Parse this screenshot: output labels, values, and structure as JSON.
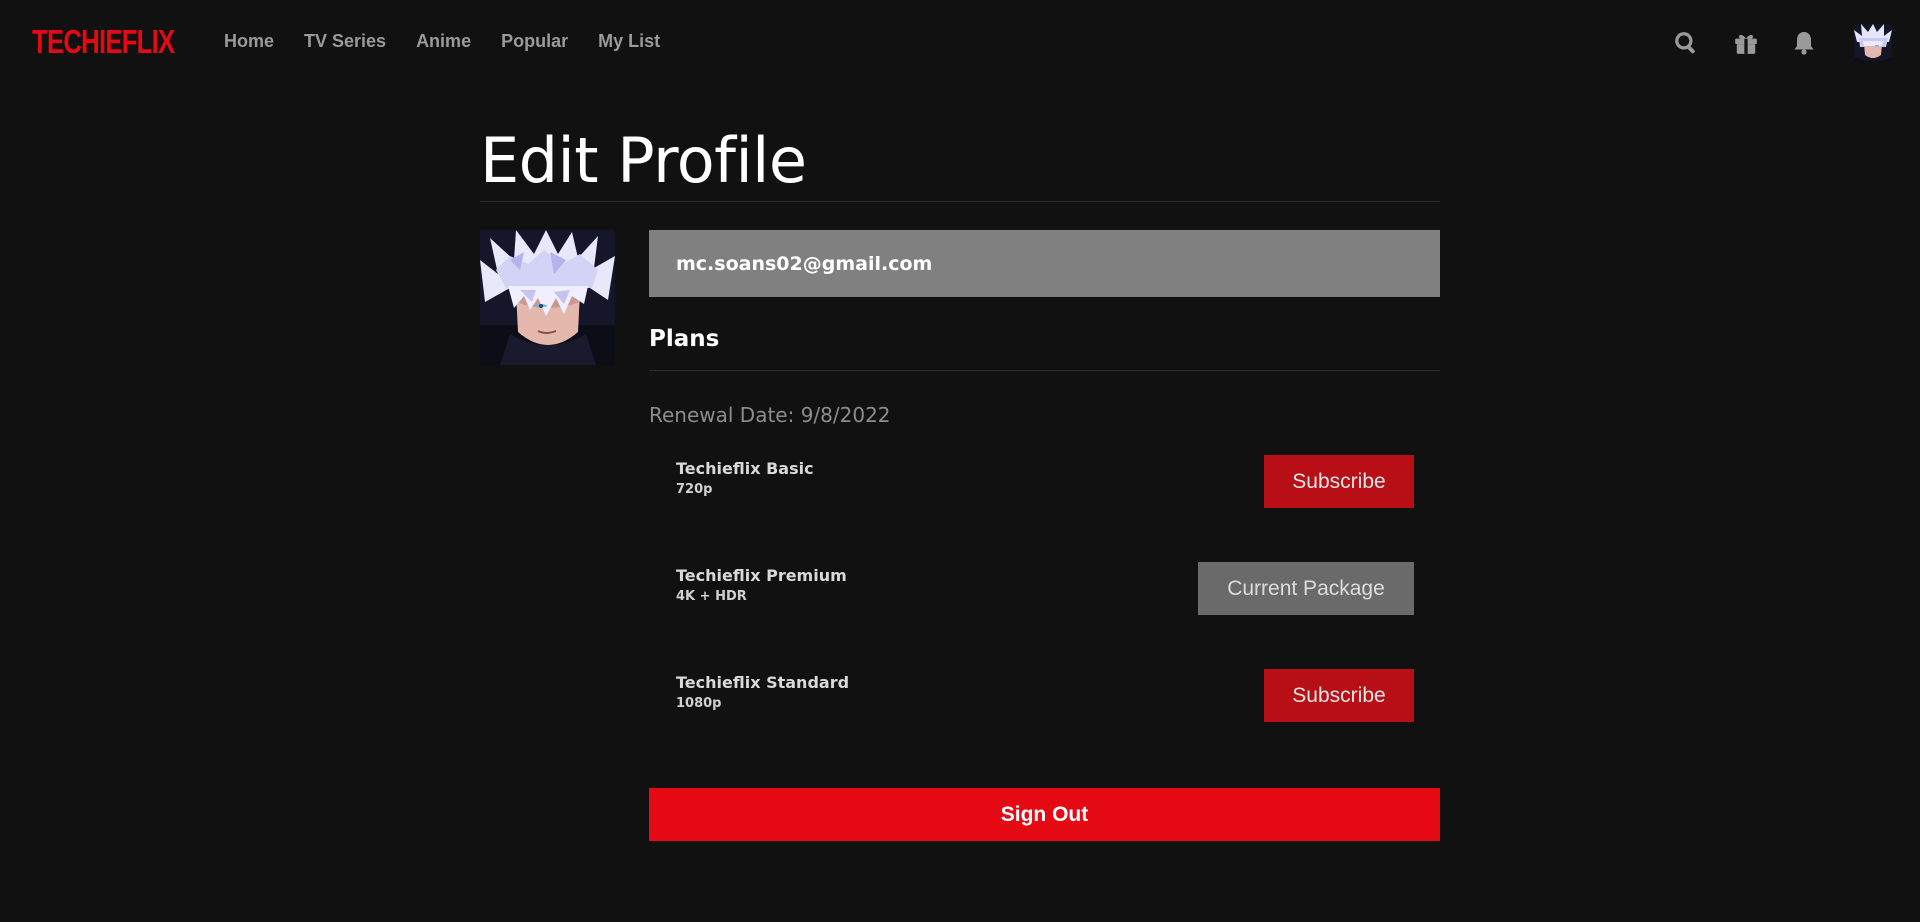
{
  "brand": {
    "name": "TECHIEFLIX",
    "color": "#e50914"
  },
  "nav": {
    "links": [
      {
        "label": "Home"
      },
      {
        "label": "TV Series"
      },
      {
        "label": "Anime"
      },
      {
        "label": "Popular"
      },
      {
        "label": "My List"
      }
    ],
    "icons": [
      "search-icon",
      "gift-icon",
      "bell-icon",
      "user-avatar"
    ]
  },
  "page": {
    "title": "Edit Profile"
  },
  "profile": {
    "email": "mc.soans02@gmail.com"
  },
  "plans": {
    "heading": "Plans",
    "renewal": "Renewal Date: 9/8/2022",
    "items": [
      {
        "name": "Techieflix Basic",
        "resolution": "720p",
        "button": "Subscribe",
        "current": false
      },
      {
        "name": "Techieflix Premium",
        "resolution": "4K + HDR",
        "button": "Current Package",
        "current": true
      },
      {
        "name": "Techieflix Standard",
        "resolution": "1080p",
        "button": "Subscribe",
        "current": false
      }
    ]
  },
  "actions": {
    "sign_out": "Sign Out"
  },
  "colors": {
    "background": "#111111",
    "email_bar": "#808080",
    "subscribe": "#b80e16",
    "current_package": "#6a6a6a",
    "sign_out": "#e50914"
  }
}
